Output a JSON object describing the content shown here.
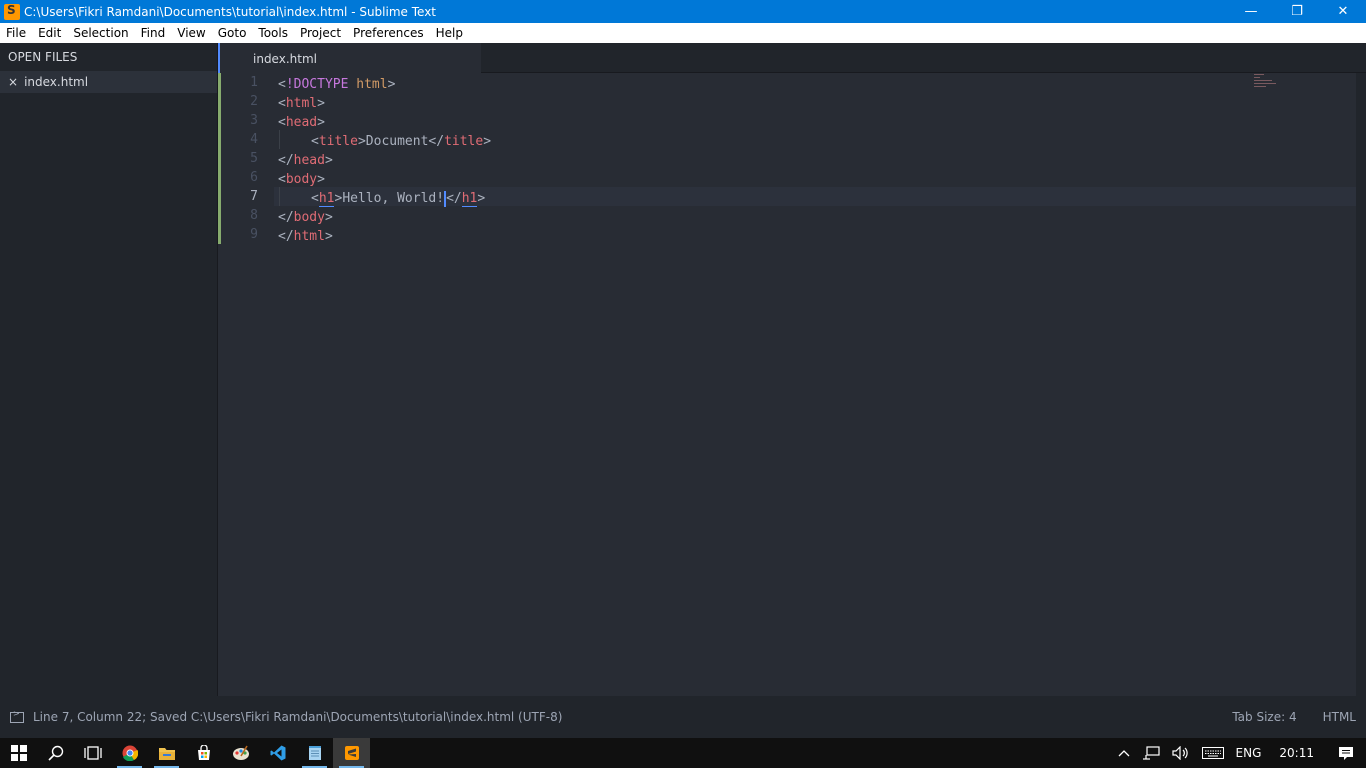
{
  "window": {
    "title": "C:\\Users\\Fikri Ramdani\\Documents\\tutorial\\index.html - Sublime Text",
    "minimize": "—",
    "maximize": "❐",
    "close": "✕"
  },
  "menu": [
    "File",
    "Edit",
    "Selection",
    "Find",
    "View",
    "Goto",
    "Tools",
    "Project",
    "Preferences",
    "Help"
  ],
  "sidebar": {
    "header": "OPEN FILES",
    "files": [
      {
        "name": "index.html",
        "close": "×"
      }
    ]
  },
  "tabs": [
    {
      "label": "index.html"
    }
  ],
  "editor": {
    "line_numbers": [
      "1",
      "2",
      "3",
      "4",
      "5",
      "6",
      "7",
      "8",
      "9"
    ],
    "active_line": 7,
    "cursor": {
      "line": 7,
      "column": 22
    },
    "code": [
      "<!DOCTYPE html>",
      "<html>",
      "<head>",
      "    <title>Document</title>",
      "</head>",
      "<body>",
      "    <h1>Hello, World!</h1>",
      "</body>",
      "</html>"
    ]
  },
  "tokens": {
    "l1": {
      "o": "<",
      "bang": "!",
      "k": "DOCTYPE",
      "sp": " ",
      "a": "html",
      "c": ">"
    },
    "l2": {
      "o": "<",
      "t": "html",
      "c": ">"
    },
    "l3": {
      "o": "<",
      "t": "head",
      "c": ">"
    },
    "l4": {
      "o": "<",
      "t": "title",
      "c": ">",
      "txt": "Document",
      "o2": "</",
      "t2": "title",
      "c2": ">"
    },
    "l5": {
      "o": "</",
      "t": "head",
      "c": ">"
    },
    "l6": {
      "o": "<",
      "t": "body",
      "c": ">"
    },
    "l7": {
      "o": "<",
      "t": "h1",
      "c": ">",
      "txt": "Hello, World!",
      "o2": "</",
      "t2": "h1",
      "c2": ">"
    },
    "l8": {
      "o": "</",
      "t": "body",
      "c": ">"
    },
    "l9": {
      "o": "</",
      "t": "html",
      "c": ">"
    }
  },
  "status": {
    "message": "Line 7, Column 22; Saved C:\\Users\\Fikri Ramdani\\Documents\\tutorial\\index.html (UTF-8)",
    "tab_size": "Tab Size: 4",
    "syntax": "HTML"
  },
  "taskbar": {
    "apps": [
      "start-icon",
      "search-icon",
      "task-view-icon",
      "chrome-icon",
      "file-explorer-icon",
      "store-icon",
      "paint-icon",
      "vscode-icon",
      "notepad-icon",
      "sublime-text-icon"
    ],
    "language": "ENG",
    "time": "20:11"
  },
  "colors": {
    "titlebar": "#0078d7",
    "editor_bg": "#282c34",
    "sidebar_bg": "#21252b",
    "tag": "#e06c75",
    "keyword": "#c678dd",
    "attribute": "#d19a66",
    "modified_marker": "#98c379",
    "caret": "#528bff"
  }
}
